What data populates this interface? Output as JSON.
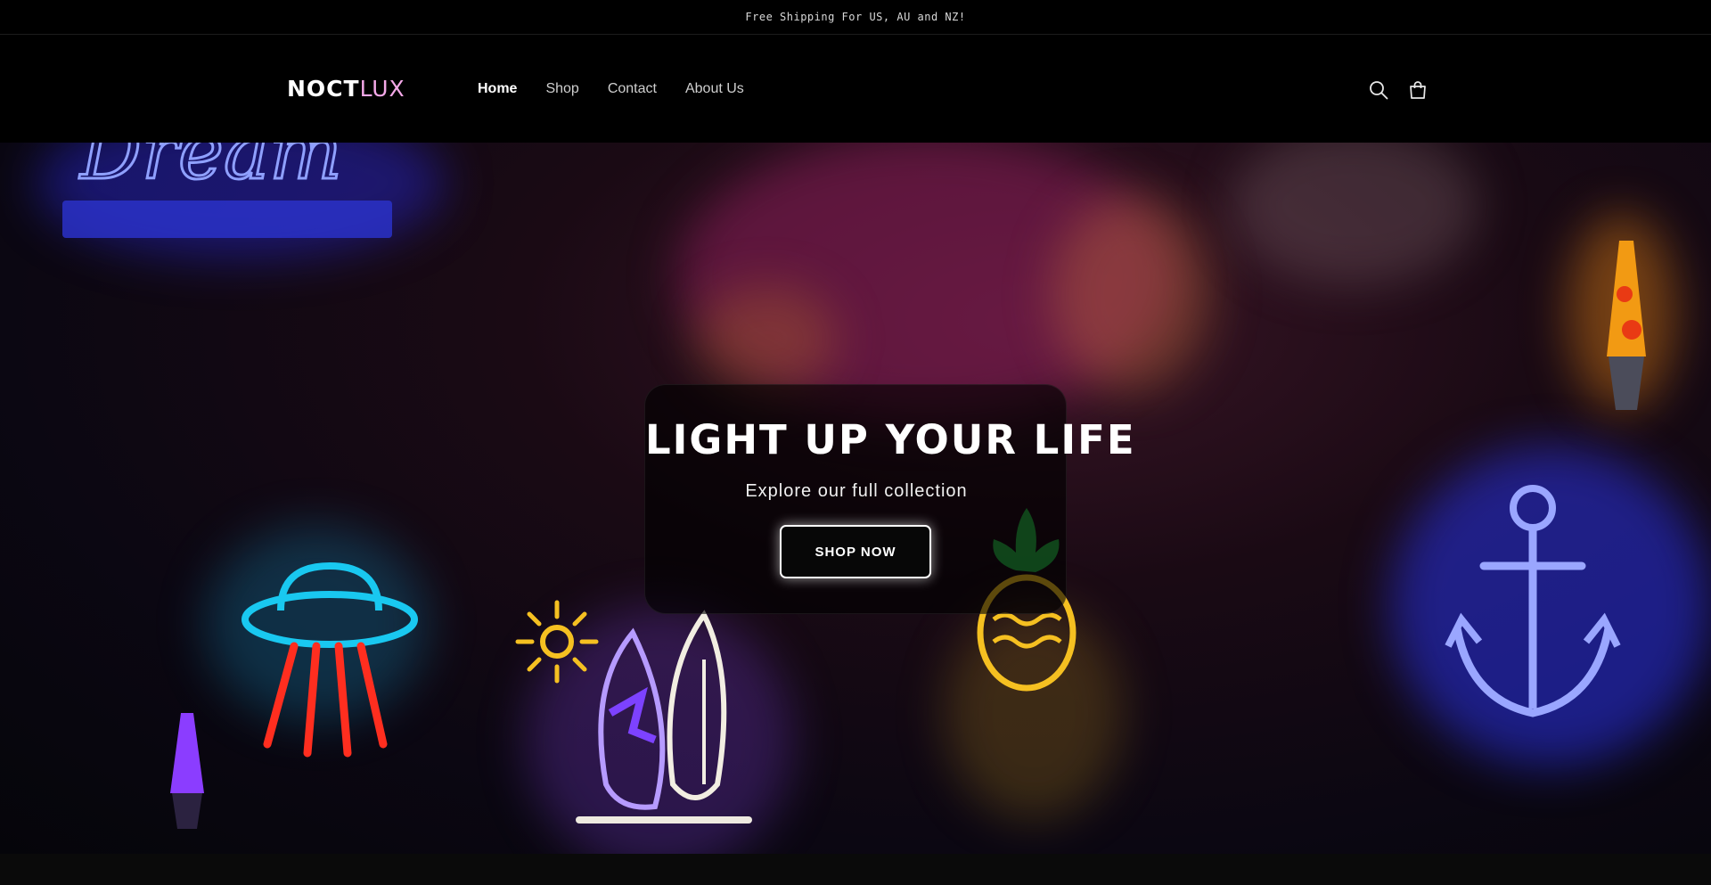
{
  "announcement": {
    "text": "Free Shipping For US, AU and NZ!"
  },
  "header": {
    "logo": {
      "part1": "NOCT",
      "part2": "LUX"
    },
    "nav": [
      {
        "label": "Home",
        "active": true
      },
      {
        "label": "Shop",
        "active": false
      },
      {
        "label": "Contact",
        "active": false
      },
      {
        "label": "About Us",
        "active": false
      }
    ],
    "icons": [
      "search-icon",
      "cart-icon"
    ]
  },
  "hero": {
    "title": "LIGHT UP YOUR LIFE",
    "subtitle": "Explore our full collection",
    "button_label": "SHOP NOW",
    "neon_signs": [
      "Dream",
      "ufo",
      "sun",
      "surfboards",
      "pineapple",
      "anchor",
      "lava-lamp"
    ]
  },
  "colors": {
    "background": "#000000",
    "logo_accent": "#f4a8e8",
    "neon_blue": "#3c4bff",
    "neon_cyan": "#19c8f0",
    "neon_yellow": "#f5c021",
    "neon_purple": "#8b3dff"
  }
}
